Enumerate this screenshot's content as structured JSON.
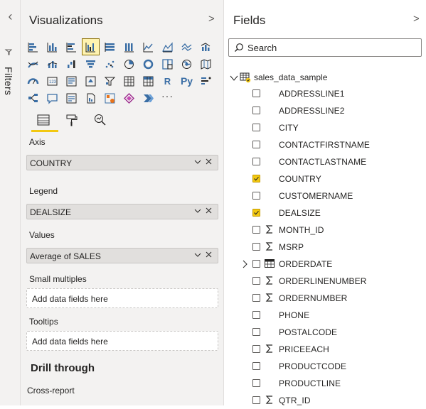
{
  "filters": {
    "label": "Filters"
  },
  "visualizations": {
    "title": "Visualizations",
    "tools": [
      "Axis"
    ],
    "wells": {
      "axis": {
        "label": "Axis",
        "field": "COUNTRY"
      },
      "legend": {
        "label": "Legend",
        "field": "DEALSIZE"
      },
      "values": {
        "label": "Values",
        "field": "Average of SALES"
      },
      "small_multiples": {
        "label": "Small multiples",
        "placeholder": "Add data fields here"
      },
      "tooltips": {
        "label": "Tooltips",
        "placeholder": "Add data fields here"
      }
    },
    "drill_through": {
      "title": "Drill through",
      "cross_report": "Cross-report"
    },
    "icon_text": {
      "r": "R",
      "py": "Py",
      "more": "···"
    }
  },
  "fields": {
    "title": "Fields",
    "search": {
      "placeholder": "Search"
    },
    "table": {
      "name": "sales_data_sample"
    },
    "items": [
      {
        "name": "ADDRESSLINE1",
        "checked": false,
        "type": "text"
      },
      {
        "name": "ADDRESSLINE2",
        "checked": false,
        "type": "text"
      },
      {
        "name": "CITY",
        "checked": false,
        "type": "text"
      },
      {
        "name": "CONTACTFIRSTNAME",
        "checked": false,
        "type": "text"
      },
      {
        "name": "CONTACTLASTNAME",
        "checked": false,
        "type": "text"
      },
      {
        "name": "COUNTRY",
        "checked": true,
        "type": "text"
      },
      {
        "name": "CUSTOMERNAME",
        "checked": false,
        "type": "text"
      },
      {
        "name": "DEALSIZE",
        "checked": true,
        "type": "text"
      },
      {
        "name": "MONTH_ID",
        "checked": false,
        "type": "sum"
      },
      {
        "name": "MSRP",
        "checked": false,
        "type": "sum"
      },
      {
        "name": "ORDERDATE",
        "checked": false,
        "type": "date"
      },
      {
        "name": "ORDERLINENUMBER",
        "checked": false,
        "type": "sum"
      },
      {
        "name": "ORDERNUMBER",
        "checked": false,
        "type": "sum"
      },
      {
        "name": "PHONE",
        "checked": false,
        "type": "text"
      },
      {
        "name": "POSTALCODE",
        "checked": false,
        "type": "text"
      },
      {
        "name": "PRICEEACH",
        "checked": false,
        "type": "sum"
      },
      {
        "name": "PRODUCTCODE",
        "checked": false,
        "type": "text"
      },
      {
        "name": "PRODUCTLINE",
        "checked": false,
        "type": "text"
      },
      {
        "name": "QTR_ID",
        "checked": false,
        "type": "sum"
      }
    ]
  },
  "colors": {
    "accent": "#f2c811",
    "pane_bg": "#f3f2f1",
    "well_bg": "#e1dfdd"
  }
}
